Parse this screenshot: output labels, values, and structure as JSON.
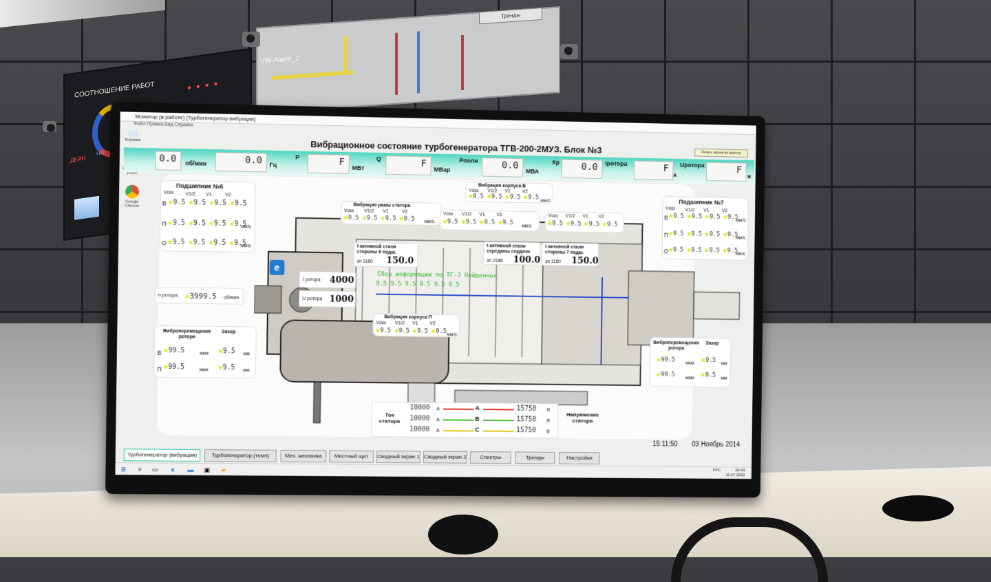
{
  "room": {
    "left_panel_title": "СООТНОШЕНИЕ РАБОТ",
    "left_panel_label": "ДЕЙН",
    "left_panel_label2": "НА",
    "center_panel_alarm": "VW-Alarm_2",
    "center_panel_button": "Тренды"
  },
  "window": {
    "title": "Монитор (в работе) [Турбогенератор вибрация]",
    "menu": "Файл   Правка   Вид   Справка"
  },
  "desktop": {
    "icons": [
      {
        "label": "VLC media player",
        "color": "#f08a00"
      },
      {
        "label": "Google Chrome",
        "color": "#e04a3a"
      }
    ],
    "top_icon_label": "Корзина"
  },
  "app": {
    "title": "Вибрационное состояние турбогенератора ТГВ-200-2МУЗ. Блок №3",
    "print_button": "Печать экрана на принтер"
  },
  "topbar": {
    "speed": {
      "value": "0.0",
      "unit": "об/мин"
    },
    "freq": {
      "value": "0.0",
      "unit": "Гц"
    },
    "p": {
      "label": "P",
      "value": "F",
      "unit": "МВт"
    },
    "q": {
      "label": "Q",
      "value": "F",
      "unit": "МВар"
    },
    "ppoln": {
      "label": "Рполн",
      "value": "0.0",
      "unit": "МВА"
    },
    "kr": {
      "label": "Кр",
      "value": "0.0"
    },
    "irotora": {
      "label": "Iротора",
      "value": "F",
      "unit": "А"
    },
    "urotora": {
      "label": "Uротора",
      "value": "F",
      "unit": "В"
    }
  },
  "bearing6": {
    "title": "Подшипник №6",
    "cols": [
      "Vскз",
      "V1/2",
      "V1",
      "V2"
    ],
    "rows": [
      {
        "axis": "В",
        "values": [
          "9.5",
          "9.5",
          "9.5",
          "9.5"
        ],
        "unit": ""
      },
      {
        "axis": "П",
        "values": [
          "9.5",
          "9.5",
          "9.5",
          "9.5"
        ],
        "unit": "мм/с"
      },
      {
        "axis": "О",
        "values": [
          "9.5",
          "9.5",
          "9.5",
          "9.5"
        ],
        "unit": "мм/с"
      }
    ]
  },
  "bearing7": {
    "title": "Подшипник №7",
    "cols": [
      "Vскз",
      "V1/2",
      "V1",
      "V2"
    ],
    "rows": [
      {
        "axis": "В",
        "values": [
          "9.5",
          "9.5",
          "9.5",
          "9.5"
        ],
        "unit": "мм/с"
      },
      {
        "axis": "П",
        "values": [
          "9.5",
          "9.5",
          "9.5",
          "9.5"
        ],
        "unit": "мм/с"
      },
      {
        "axis": "О",
        "values": [
          "9.5",
          "9.5",
          "9.5",
          "9.5"
        ],
        "unit": "мм/с"
      }
    ]
  },
  "frame_vib": {
    "title": "Вибрация рамы статора",
    "cols": [
      "Vскз",
      "V1/2",
      "V1",
      "V2"
    ],
    "values": [
      "9.5",
      "9.5",
      "9.5",
      "9.5"
    ],
    "unit": "мм/с"
  },
  "housing_vib_top": {
    "title": "Вибрация корпуса В",
    "cols": [
      "Vскз",
      "V1/2",
      "V1",
      "V2"
    ],
    "values": [
      "9.5",
      "9.5",
      "9.5",
      "9.5"
    ],
    "unit": "мм/с"
  },
  "housing_vib_top2": {
    "cols": [
      "Vскз",
      "V1/2",
      "V1",
      "V2"
    ],
    "values": [
      "9.5",
      "9.5",
      "9.5",
      "9.5"
    ],
    "unit": "мм/с"
  },
  "housing_vib_mid": {
    "title": "Вибрация корпуса П",
    "cols": [
      "Vскз",
      "V1/2",
      "V1",
      "V2"
    ],
    "values": [
      "9.5",
      "9.5",
      "9.5",
      "9.5"
    ],
    "unit": "мм/с"
  },
  "core_temp_left": {
    "title": "t активной стали стороны 6 подш.",
    "value": "150.0",
    "prefix": "зп 1180"
  },
  "core_temp_mid": {
    "title": "t активной стали середины сердечн",
    "value": "100.0",
    "prefix": "зп 2186"
  },
  "core_temp_right": {
    "title": "t активной стали стороны 7 подш.",
    "value": "150.0",
    "prefix": "зп 1180"
  },
  "rotor": {
    "irotor_label": "I ротора",
    "irotor_value": "4000",
    "urotor_label": "U ротора",
    "urotor_value": "1000",
    "n_label": "n ротора",
    "n_value": "3999.5",
    "n_unit": "об/мин"
  },
  "log": {
    "line1": "Сбор информации по ТГ-3 Найденных",
    "line2": "9.5   9.5   9.5   9.5   9.5   9.5"
  },
  "shaft_left": {
    "title": "Виброперемещения ротора",
    "gap_title": "Зазор",
    "rows": [
      {
        "axis": "В",
        "value": "99.5",
        "unit": "мкм",
        "gap": "9.5",
        "gap_unit": "мм"
      },
      {
        "axis": "П",
        "value": "99.5",
        "unit": "мкм",
        "gap": "9.5",
        "gap_unit": "мм"
      }
    ]
  },
  "shaft_right": {
    "title": "Виброперемещения ротора",
    "gap_title": "Зазор",
    "rows": [
      {
        "value": "99.5",
        "unit": "мкм",
        "gap": "9.5",
        "gap_unit": "мм"
      },
      {
        "value": "99.5",
        "unit": "мкм",
        "gap": "9.5",
        "gap_unit": "мм"
      }
    ]
  },
  "stator": {
    "current_label": "Ток статора",
    "voltage_label": "Напряжение статора",
    "phases": [
      {
        "name": "A",
        "current": "10000",
        "cunit": "А",
        "voltage": "15750",
        "vunit": "В",
        "color": "#e23a2a"
      },
      {
        "name": "B",
        "current": "10000",
        "cunit": "А",
        "voltage": "15750",
        "vunit": "В",
        "color": "#3fbf2f"
      },
      {
        "name": "C",
        "current": "10000",
        "cunit": "А",
        "voltage": "15750",
        "vunit": "В",
        "color": "#e8c21a"
      }
    ]
  },
  "clock": {
    "time": "15:11:50",
    "date": "03 Ноябрь 2014"
  },
  "tabs": [
    "Турбогенератор (вибрация)",
    "Турбогенератор (темп)",
    "Мех. механика",
    "Местный щит",
    "Сводный экран 1",
    "Сводный экран 2",
    "Спектры",
    "Тренды",
    "Настройки"
  ],
  "taskbar": {
    "lang": "РУС",
    "time": "20:43",
    "date": "11.07.2022"
  }
}
